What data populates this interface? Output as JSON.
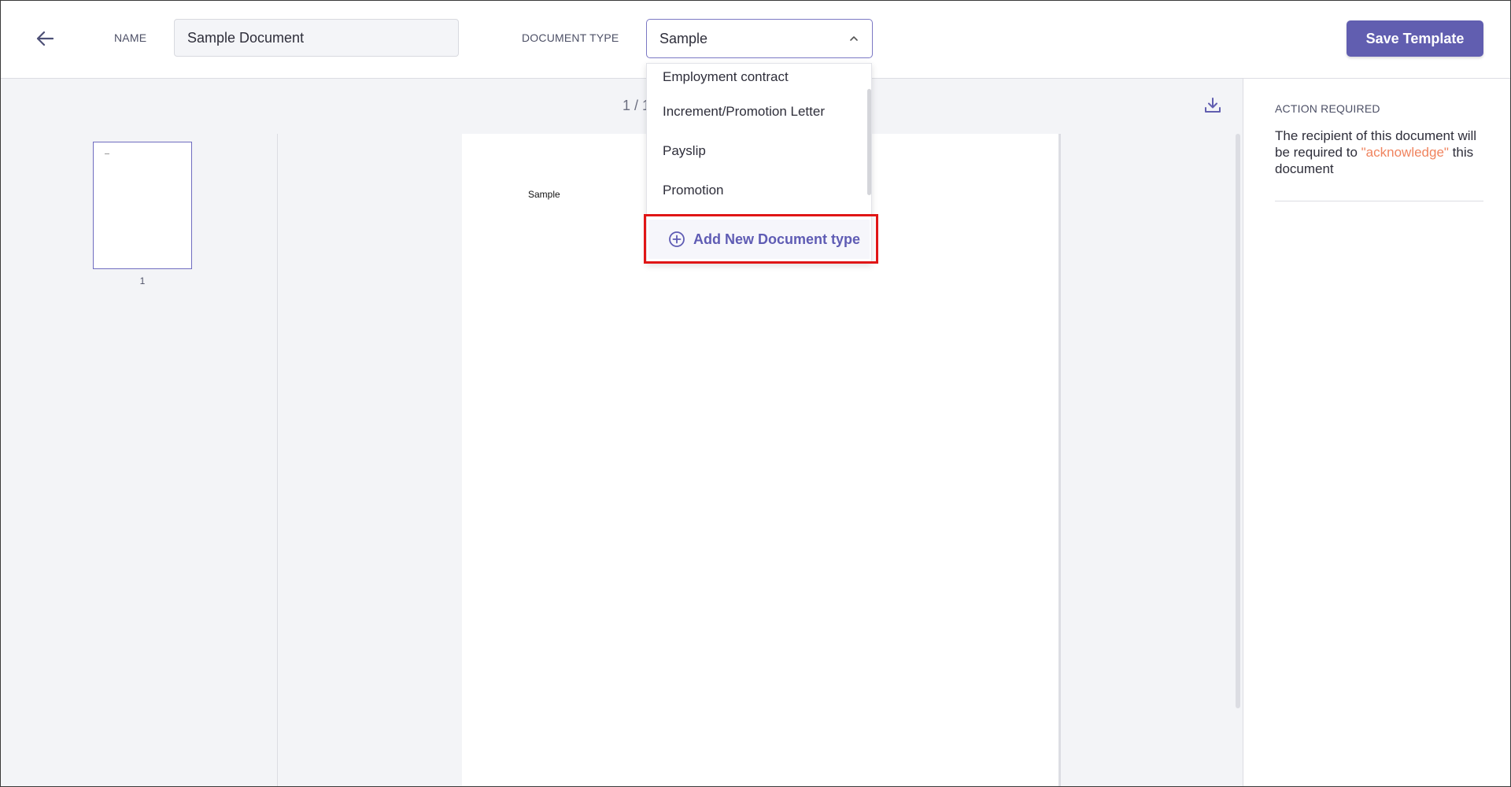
{
  "header": {
    "name_label": "NAME",
    "name_value": "Sample Document",
    "doctype_label": "DOCUMENT TYPE",
    "doctype_value": "Sample",
    "save_label": "Save Template"
  },
  "toolbar": {
    "page_indicator": "1 / 1"
  },
  "thumbnails": [
    {
      "page": "1"
    }
  ],
  "document": {
    "text": "Sample"
  },
  "dropdown": {
    "options": [
      "Employment contract",
      "Increment/Promotion Letter",
      "Payslip",
      "Promotion"
    ],
    "add_label": "Add New Document type"
  },
  "action_panel": {
    "title": "ACTION REQUIRED",
    "text_before": "The recipient of this document will be required to ",
    "text_highlight": "\"acknowledge\"",
    "text_after": " this document"
  },
  "colors": {
    "primary": "#615eb0",
    "accent": "#f0845f",
    "highlight_box": "#e01616"
  },
  "icons": {
    "back": "arrow-left-icon",
    "chevron": "chevron-up-icon",
    "download": "download-icon",
    "add": "plus-circle-icon"
  }
}
